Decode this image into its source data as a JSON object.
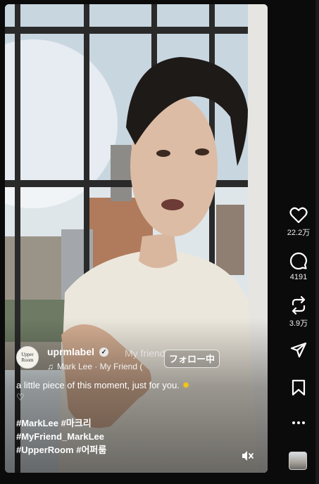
{
  "post": {
    "avatar_text_1": "Upper",
    "avatar_text_2": "Room",
    "username": "uprmlabel",
    "verified_mark": "✓",
    "song": "Mark Lee · My Friend (",
    "ghost_title": "My friend",
    "follow_label": "フォロー中",
    "caption": "a little piece of this moment, just for you.",
    "caption_emoji": "✹",
    "caption_heart": "♡",
    "hashtags": [
      "#MarkLee #마크리",
      "#MyFriend_MarkLee",
      "#UpperRoom #어퍼룸"
    ]
  },
  "sidebar": {
    "like_count": "22.2万",
    "comment_count": "4191",
    "repost_count": "3.9万"
  },
  "icons": {
    "like": "heart-icon",
    "comment": "comment-icon",
    "repost": "repost-icon",
    "share": "share-icon",
    "save": "bookmark-icon",
    "more": "more-icon",
    "mute": "mute-icon",
    "music": "music-note-icon"
  }
}
